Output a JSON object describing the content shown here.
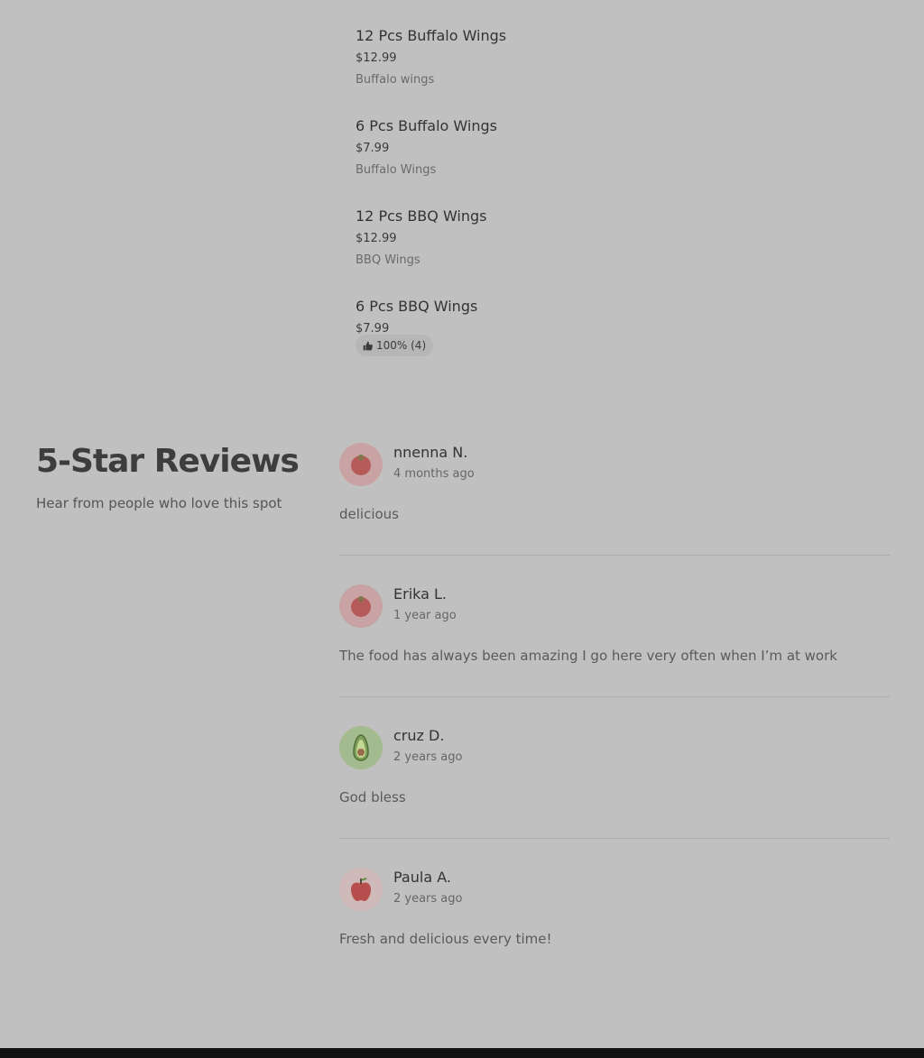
{
  "menu": {
    "items": [
      {
        "name": "12 Pcs Buffalo Wings",
        "price": "$12.99",
        "description": "Buffalo wings"
      },
      {
        "name": "6 Pcs Buffalo Wings",
        "price": "$7.99",
        "description": "Buffalo Wings"
      },
      {
        "name": "12 Pcs BBQ Wings",
        "price": "$12.99",
        "description": "BBQ Wings"
      },
      {
        "name": "6 Pcs BBQ Wings",
        "price": "$7.99",
        "rating": "100% (4)",
        "rating_icon": "thumbs-up-icon"
      }
    ]
  },
  "reviews_section": {
    "heading": "5-Star Reviews",
    "subheading": "Hear from people who love this spot",
    "reviews": [
      {
        "name": "nnenna N.",
        "time": "4 months ago",
        "text": "delicious",
        "avatar_icon": "tomato-icon",
        "avatar_bg": "#c9a3a3"
      },
      {
        "name": "Erika L.",
        "time": "1 year ago",
        "text": "The food has always been amazing I go here very often when I’m at work",
        "avatar_icon": "tomato-icon",
        "avatar_bg": "#c9a3a3"
      },
      {
        "name": "cruz D.",
        "time": "2 years ago",
        "text": "God bless",
        "avatar_icon": "avocado-icon",
        "avatar_bg": "#a3bb8e"
      },
      {
        "name": "Paula A.",
        "time": "2 years ago",
        "text": "Fresh and delicious every time!",
        "avatar_icon": "apple-icon",
        "avatar_bg": "#cfb9b9"
      }
    ]
  },
  "colors": {
    "background": "#c0c0c0",
    "text_primary": "#333333",
    "text_secondary": "#6a6a6a",
    "footer": "#111111"
  }
}
